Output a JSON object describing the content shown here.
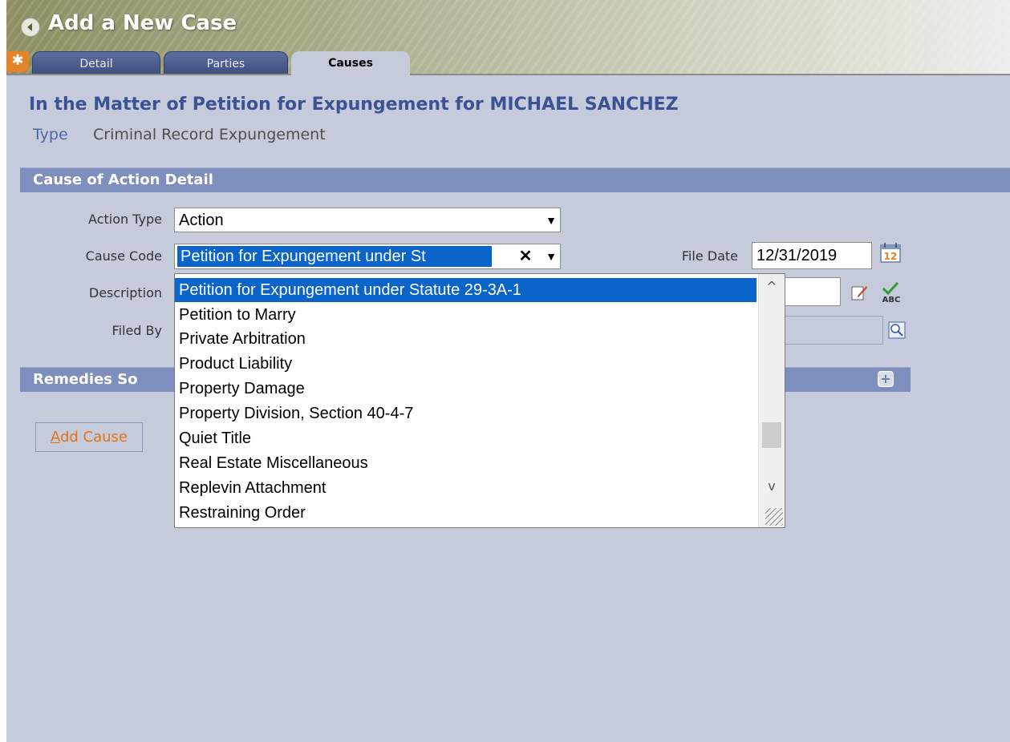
{
  "header": {
    "title": "Add a New Case",
    "tabs": [
      {
        "label": "Detail",
        "active": false
      },
      {
        "label": "Parties",
        "active": false
      },
      {
        "label": "Causes",
        "active": true
      }
    ]
  },
  "case": {
    "title": "In the Matter of Petition for Expungement for MICHAEL SANCHEZ",
    "type_label": "Type",
    "type_value": "Criminal Record Expungement"
  },
  "cause_detail": {
    "section_title": "Cause of Action Detail",
    "action_type": {
      "label": "Action Type",
      "value": "Action"
    },
    "cause_code": {
      "label": "Cause Code",
      "value": "Petition for Expungement under St"
    },
    "file_date": {
      "label": "File Date",
      "value": "12/31/2019"
    },
    "description": {
      "label": "Description",
      "value": ""
    },
    "filed_by": {
      "label": "Filed By",
      "value": ""
    }
  },
  "remedies": {
    "section_title": "Remedies So"
  },
  "add_cause": {
    "prefix": "A",
    "rest": "dd Cause"
  },
  "dropdown": {
    "items": [
      "Petition for Expungement under Statute 29-3A-1",
      "Petition to Marry",
      "Private Arbitration",
      "Product Liability",
      "Property Damage",
      "Property Division, Section 40-4-7",
      "Quiet Title",
      "Real Estate Miscellaneous",
      "Replevin Attachment",
      "Restraining Order"
    ],
    "selected_index": 0
  },
  "icons": {
    "calendar": "calendar-icon",
    "edit": "edit-note-icon",
    "spellcheck": "spellcheck-icon",
    "lookup": "lookup-icon",
    "expand": "plus-icon"
  },
  "colors": {
    "accent": "#0a64c9",
    "section_bar": "#7f8fbd",
    "page_bg": "#c6cbdc",
    "link": "#e27419"
  }
}
